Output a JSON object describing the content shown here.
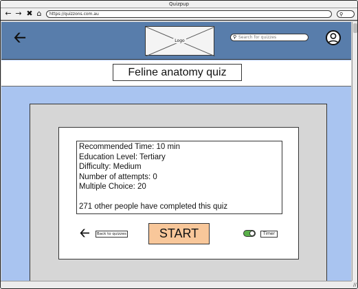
{
  "browser": {
    "window_title": "Quizpup",
    "url": "https://quizzons.com.au",
    "nav": {
      "back_icon": "←",
      "forward_icon": "→",
      "close_icon": "✖",
      "home_icon": "⌂"
    }
  },
  "header": {
    "logo_text": "Logo",
    "search_placeholder": "Search for quizzes"
  },
  "quiz": {
    "title": "Feline anatomy quiz",
    "details": {
      "recommended_time": "Recommended Time: 10 min",
      "education_level": "Education Level: Tertiary",
      "difficulty": "Difficulty: Medium",
      "attempts": "Number of attempts: 0",
      "multiple_choice": "Multiple Choice: 20",
      "completed": "271 other people have completed this quiz"
    }
  },
  "actions": {
    "back_label": "Back to quizzes",
    "start_label": "START",
    "timer_label": "Timer",
    "timer_on": true
  },
  "colors": {
    "header": "#587dab",
    "page_bg": "#a9c4f0",
    "start_button": "#f8c79a",
    "toggle_on": "#5ab04a"
  }
}
